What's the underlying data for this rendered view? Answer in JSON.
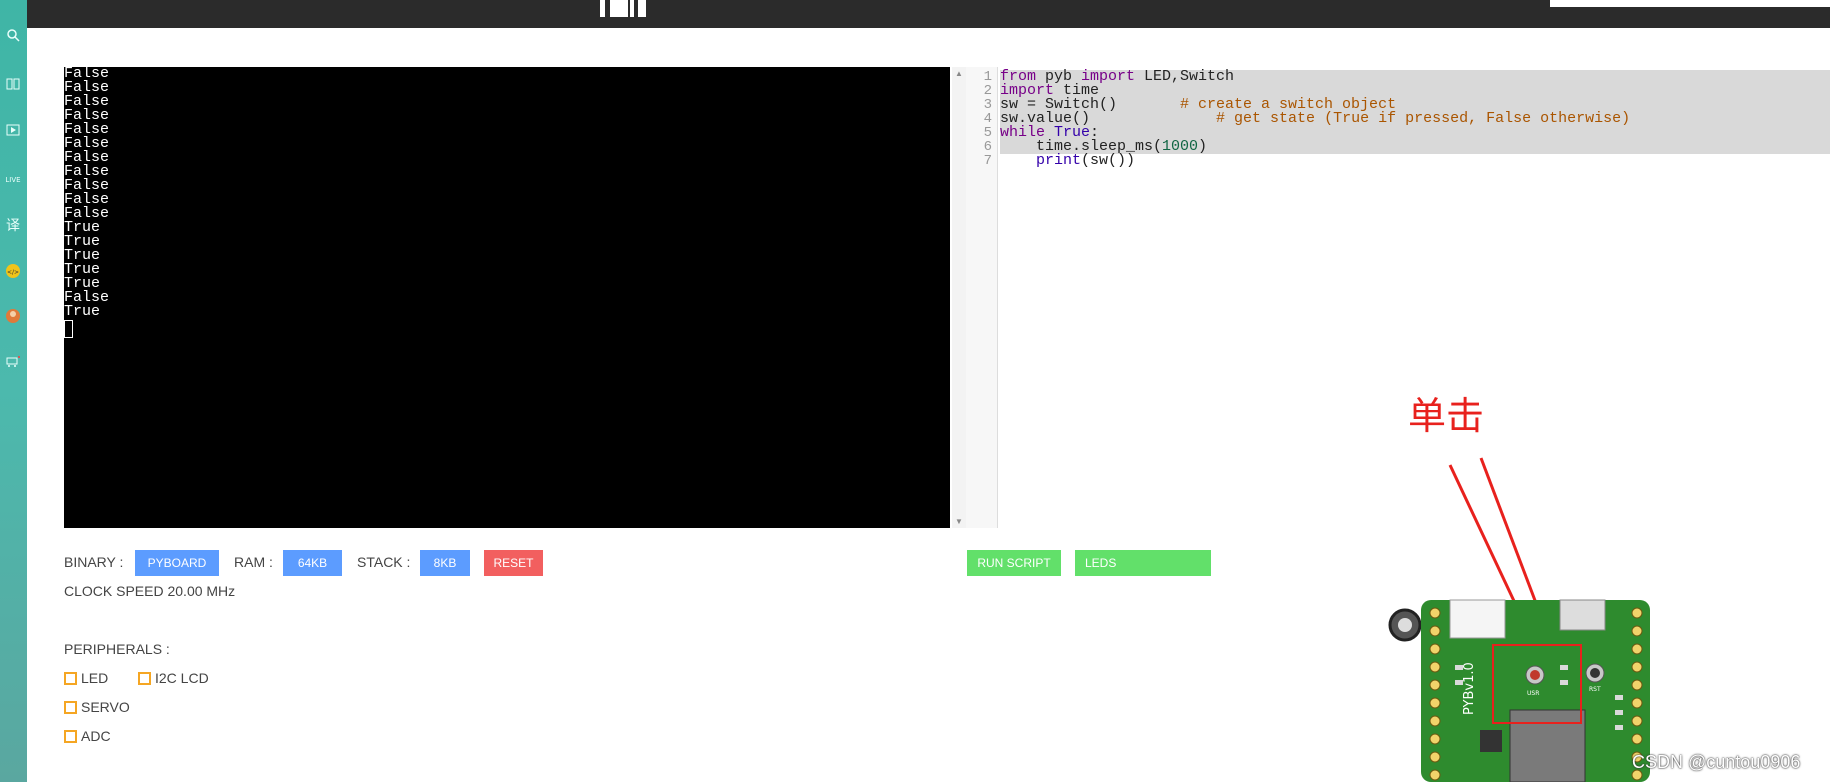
{
  "sidebar": {
    "icons": [
      "search-icon",
      "book-icon",
      "video-icon",
      "live-icon",
      "translate-icon",
      "code-icon",
      "avatar-icon",
      "cart-icon"
    ],
    "live_label": "LIVE"
  },
  "terminal": {
    "lines": [
      "False",
      "False",
      "False",
      "False",
      "False",
      "False",
      "False",
      "False",
      "False",
      "False",
      "False",
      "True",
      "True",
      "True",
      "True",
      "True",
      "False",
      "True"
    ]
  },
  "editor": {
    "line_numbers": [
      "1",
      "2",
      "3",
      "4",
      "5",
      "6",
      "7"
    ],
    "code": {
      "l1_kw1": "from",
      "l1_a": " pyb ",
      "l1_kw2": "import",
      "l1_b": " LED,Switch",
      "l2_kw": "import",
      "l2_a": " time",
      "l3_a": "sw = Switch()       ",
      "l3_cm": "# create a switch object",
      "l4_a": "sw.value()              ",
      "l4_cm": "# get state (True if pressed, False otherwise)",
      "l5_kw": "while",
      "l5_sp": " ",
      "l5_bi": "True",
      "l5_a": ":",
      "l6_a": "    time.sleep_ms(",
      "l6_num": "1000",
      "l6_b": ")",
      "l7_a": "    ",
      "l7_bi": "print",
      "l7_b": "(sw())"
    }
  },
  "controls": {
    "binary_label": "BINARY :",
    "binary_button": "PYBOARD",
    "ram_label": "RAM :",
    "ram_button": "64KB",
    "stack_label": "STACK :",
    "stack_button": "8KB",
    "reset_button": "RESET",
    "run_button": "RUN SCRIPT",
    "leds_button": "LEDS",
    "clock_speed": "CLOCK SPEED 20.00 MHz"
  },
  "peripherals": {
    "title": "PERIPHERALS :",
    "items": [
      "LED",
      "I2C LCD",
      "SERVO",
      "ADC"
    ]
  },
  "annotation": {
    "text": "单击"
  },
  "board": {
    "silkscreen": "PYBv1.0",
    "usr_label": "USR",
    "rst_label": "RST"
  },
  "watermark": "CSDN @cuntou0906",
  "colors": {
    "button_blue": "#5c9cff",
    "button_red": "#f25f5f",
    "button_green": "#62e06a",
    "annotation_red": "#e8211d",
    "board_green": "#2e8b2e"
  }
}
